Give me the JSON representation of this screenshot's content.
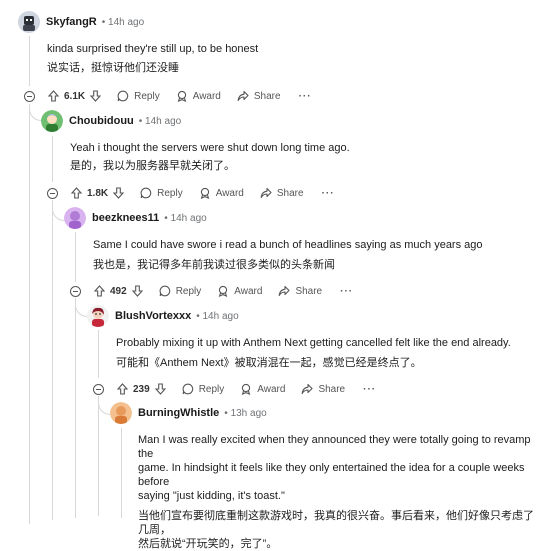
{
  "comments": [
    {
      "user": "SkyfangR",
      "time": "14h ago",
      "text_en": "kinda surprised they're still up, to be honest",
      "text_zh": "说实话，挺惊讶他们还没睡",
      "votes": "6.1K",
      "reply": "Reply",
      "award": "Award",
      "share": "Share",
      "more": "···"
    },
    {
      "user": "Choubidouu",
      "time": "14h ago",
      "text_en": "Yeah i thought the servers were shut down long time ago.",
      "text_zh": "是的，我以为服务器早就关闭了。",
      "votes": "1.8K",
      "reply": "Reply",
      "award": "Award",
      "share": "Share",
      "more": "···"
    },
    {
      "user": "beezknees11",
      "time": "14h ago",
      "text_en": "Same I could have swore i read a bunch of headlines saying as much years ago",
      "text_zh": "我也是，我记得多年前我读过很多类似的头条新闻",
      "votes": "492",
      "reply": "Reply",
      "award": "Award",
      "share": "Share",
      "more": "···"
    },
    {
      "user": "BlushVortexxx",
      "time": "14h ago",
      "text_en": "Probably mixing it up with Anthem Next getting cancelled felt like the end already.",
      "text_zh": "可能和《Anthem Next》被取消混在一起，感觉已经是终点了。",
      "votes": "239",
      "reply": "Reply",
      "award": "Award",
      "share": "Share",
      "more": "···"
    },
    {
      "user": "BurningWhistle",
      "time": "13h ago",
      "text_en_lines": [
        "Man I was really excited when they announced they were totally going to revamp the",
        "game. In hindsight it feels like they only entertained the idea for a couple weeks before",
        "saying \"just kidding, it's toast.\""
      ],
      "text_zh_lines": [
        "当他们宣布要彻底重制这款游戏时，我真的很兴奋。事后看来，他们好像只考虑了几周，",
        "然后就说“开玩笑的，完了”。"
      ]
    }
  ],
  "colors": {
    "thread_line": "#d8d8d8",
    "meta_gray": "#6f7275",
    "text": "#1c1c1c"
  }
}
